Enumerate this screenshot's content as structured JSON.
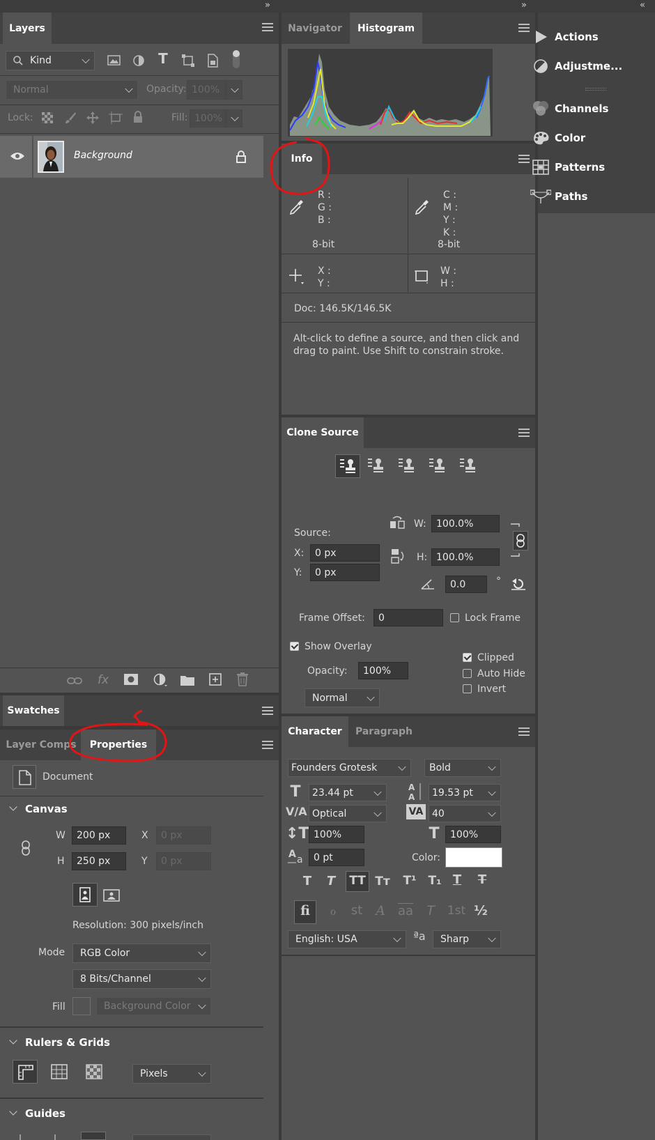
{
  "top_collapse_glyphs": [
    "»",
    "»",
    "«"
  ],
  "layers": {
    "tab": "Layers",
    "filter_kind": "Kind",
    "blend_mode": "Normal",
    "opacity_label": "Opacity:",
    "opacity_value": "100%",
    "lock_label": "Lock:",
    "fill_label": "Fill:",
    "fill_value": "100%",
    "layer_name": "Background"
  },
  "navigator": {
    "tabs": [
      "Navigator",
      "Histogram"
    ],
    "active": "Histogram"
  },
  "info": {
    "tab": "Info",
    "rgb_labels": [
      "R :",
      "G :",
      "B :"
    ],
    "cmyk_labels": [
      "C :",
      "M :",
      "Y :",
      "K :"
    ],
    "bit_depth_left": "8-bit",
    "bit_depth_right": "8-bit",
    "xy_labels": [
      "X :",
      "Y :"
    ],
    "wh_labels": [
      "W :",
      "H :"
    ],
    "doc": "Doc: 146.5K/146.5K",
    "hint": "Alt-click to define a source, and then click and drag to paint. Use Shift to constrain stroke."
  },
  "clone_source": {
    "tab": "Clone Source",
    "source_label": "Source:",
    "x_label": "X:",
    "x_value": "0 px",
    "y_label": "Y:",
    "y_value": "0 px",
    "w_label": "W:",
    "w_value": "100.0%",
    "h_label": "H:",
    "h_value": "100.0%",
    "angle_value": "0.0",
    "degree": "°",
    "frame_offset_label": "Frame Offset:",
    "frame_offset_value": "0",
    "lock_frame": "Lock Frame",
    "show_overlay": "Show Overlay",
    "opacity_label": "Opacity:",
    "opacity_value": "100%",
    "blend": "Normal",
    "clipped": "Clipped",
    "auto_hide": "Auto Hide",
    "invert": "Invert"
  },
  "character": {
    "tabs": [
      "Character",
      "Paragraph"
    ],
    "font_family": "Founders Grotesk",
    "font_style": "Bold",
    "size": "23.44 pt",
    "leading": "19.53 pt",
    "kerning": "Optical",
    "tracking": "40",
    "vscale": "100%",
    "hscale": "100%",
    "baseline": "0 pt",
    "color_label": "Color:",
    "language": "English: USA",
    "aa_glyph": "ªa",
    "antialias": "Sharp",
    "style_buttons": [
      "T",
      "T",
      "TT",
      "Tт",
      "T¹",
      "T₁",
      "T",
      "T"
    ],
    "opentype_buttons": [
      "fi",
      "ℴ",
      "st",
      "A",
      "aa",
      "T",
      "1st",
      "½"
    ]
  },
  "side": {
    "items": [
      "Actions",
      "Adjustme...",
      "Channels",
      "Color",
      "Patterns",
      "Paths"
    ]
  },
  "swatches": {
    "tab": "Swatches"
  },
  "properties": {
    "tabs": [
      "Layer Comps",
      "Properties"
    ],
    "doc_label": "Document",
    "canvas_heading": "Canvas",
    "w_label": "W",
    "w_value": "200 px",
    "h_label": "H",
    "h_value": "250 px",
    "x_label": "X",
    "x_value": "0 px",
    "y_label": "Y",
    "y_value": "0 px",
    "resolution": "Resolution: 300 pixels/inch",
    "mode_label": "Mode",
    "mode_value": "RGB Color",
    "bits_value": "8 Bits/Channel",
    "fill_label": "Fill",
    "fill_value": "Background Color",
    "rulers_heading": "Rulers & Grids",
    "units_value": "Pixels",
    "guides_heading": "Guides"
  },
  "colors": {
    "annotation": "#e01515",
    "panel": "#535353",
    "tabbar": "#424242",
    "selection": "#6a6a6a"
  }
}
